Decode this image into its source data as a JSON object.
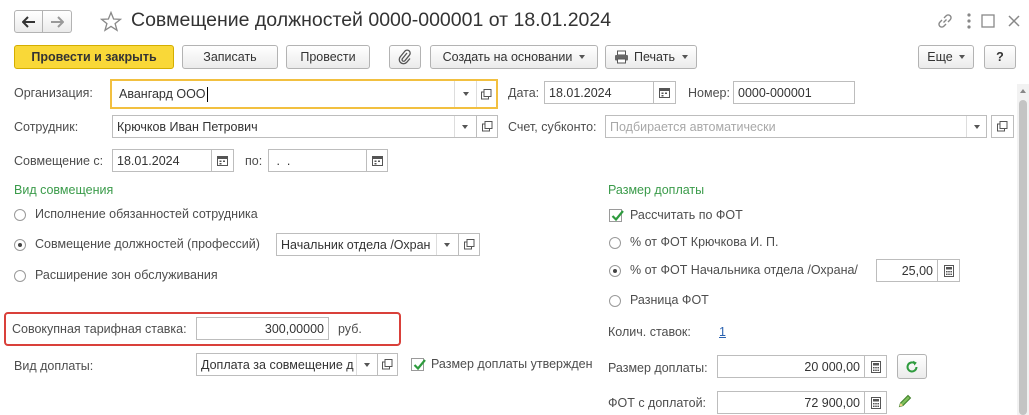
{
  "header": {
    "title": "Совмещение должностей 0000-000001 от 18.01.2024"
  },
  "toolbar": {
    "post_close": "Провести и закрыть",
    "save": "Записать",
    "post": "Провести",
    "create_based": "Создать на основании",
    "print": "Печать",
    "more": "Еще",
    "help": "?"
  },
  "form": {
    "org_label": "Организация:",
    "org_value": "Авангард ООО",
    "date_label": "Дата:",
    "date_value": "18.01.2024",
    "number_label": "Номер:",
    "number_value": "0000-000001",
    "employee_label": "Сотрудник:",
    "employee_value": "Крючков Иван Петрович",
    "account_label": "Счет, субконто:",
    "account_placeholder": "Подбирается автоматически",
    "from_label": "Совмещение с:",
    "from_value": "18.01.2024",
    "to_label": "по:",
    "to_value": " .  .",
    "kind_title": "Вид совмещения",
    "kind_options": [
      "Исполнение обязанностей сотрудника",
      "Совмещение должностей (профессий)",
      "Расширение зон обслуживания"
    ],
    "kind_selected": 1,
    "position_value": "Начальник отдела /Охран",
    "rate_label": "Совокупная тарифная ставка:",
    "rate_value": "300,00000",
    "rate_unit": "руб.",
    "payment_kind_label": "Вид доплаты:",
    "payment_kind_value": "Доплата за совмещение д",
    "approved_label": "Размер доплаты утвержден",
    "size_title": "Размер доплаты",
    "calc_fot_label": "Рассчитать по ФОТ",
    "size_options": [
      "% от ФОТ Крючкова И. П.",
      "% от ФОТ Начальника отдела /Охрана/",
      "Разница ФОТ"
    ],
    "size_selected": 1,
    "percent_value": "25,00",
    "count_label": "Колич. ставок:",
    "count_value": "1",
    "amount_label": "Размер доплаты:",
    "amount_value": "20 000,00",
    "fot_label": "ФОТ с доплатой:",
    "fot_value": "72 900,00"
  },
  "colors": {
    "primary_button": "#f9d838",
    "section_title": "#3a9b4a",
    "highlight_frame": "#d9403a",
    "link": "#2a62b0"
  }
}
